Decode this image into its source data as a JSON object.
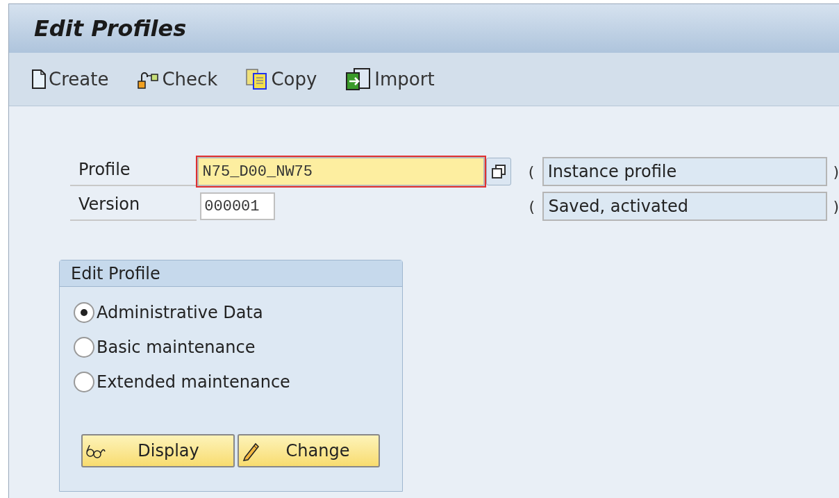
{
  "title": "Edit Profiles",
  "toolbar": [
    {
      "kind": "create",
      "label": "Create"
    },
    {
      "kind": "check",
      "label": "Check"
    },
    {
      "kind": "copy",
      "label": "Copy"
    },
    {
      "kind": "import",
      "label": "Import"
    }
  ],
  "fields": [
    {
      "label": "Profile",
      "value": "N75_D00_NW75",
      "required": true,
      "open_paren": "(",
      "description": "Instance profile",
      "close_paren": ")"
    },
    {
      "label": "Version",
      "value": "000001",
      "required": false,
      "open_paren": "(",
      "description": "Saved, activated",
      "close_paren": ")"
    }
  ],
  "group": {
    "title": "Edit Profile",
    "options": [
      {
        "label": "Administrative Data",
        "selected": true
      },
      {
        "label": "Basic maintenance",
        "selected": false
      },
      {
        "label": "Extended maintenance",
        "selected": false
      }
    ],
    "buttons": [
      {
        "kind": "display",
        "label": "Display"
      },
      {
        "kind": "change",
        "label": "Change"
      }
    ]
  }
}
